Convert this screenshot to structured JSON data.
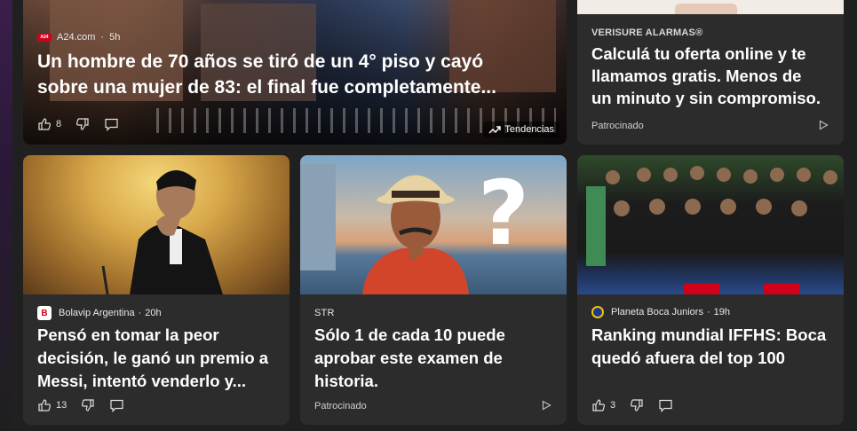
{
  "hero": {
    "source": "A24.com",
    "age": "5h",
    "logo_text": "A24",
    "headline_line1": "Un hombre de 70 años se tiró de un 4° piso y cayó",
    "headline_line2": "sobre una mujer de 83: el final fue completamente...",
    "likes": "8",
    "trend_label": "Tendencias",
    "colors": {
      "logo": "#d0021b"
    }
  },
  "ad_top": {
    "sponsor": "VERISURE ALARMAS®",
    "headline_line1": "Calculá tu oferta online y te",
    "headline_line2": "llamamos gratis. Menos de",
    "headline_line3": "un minuto y sin compromiso.",
    "sponsored_label": "Patrocinado"
  },
  "cards": [
    {
      "source": "Bolavip Argentina",
      "age": "20h",
      "logo_text": "B",
      "headline_line1": "Pensó en tomar la peor",
      "headline_line2": "decisión, le ganó un premio a",
      "headline_line3": "Messi, intentó venderlo y...",
      "likes": "13"
    },
    {
      "sponsor": "STR",
      "headline_line1": "Sólo 1 de cada 10 puede",
      "headline_line2": "aprobar este examen de",
      "headline_line3": "historia.",
      "sponsored_label": "Patrocinado"
    },
    {
      "source": "Planeta Boca Juniors",
      "age": "19h",
      "headline_line1": "Ranking mundial IFFHS: Boca",
      "headline_line2": "quedó afuera del top 100",
      "likes": "3"
    }
  ],
  "icons": {
    "like": "thumbs-up-icon",
    "dislike": "thumbs-down-icon",
    "comment": "comment-icon",
    "trend": "trending-arrow-icon",
    "ad": "ad-choices-triangle-icon"
  }
}
